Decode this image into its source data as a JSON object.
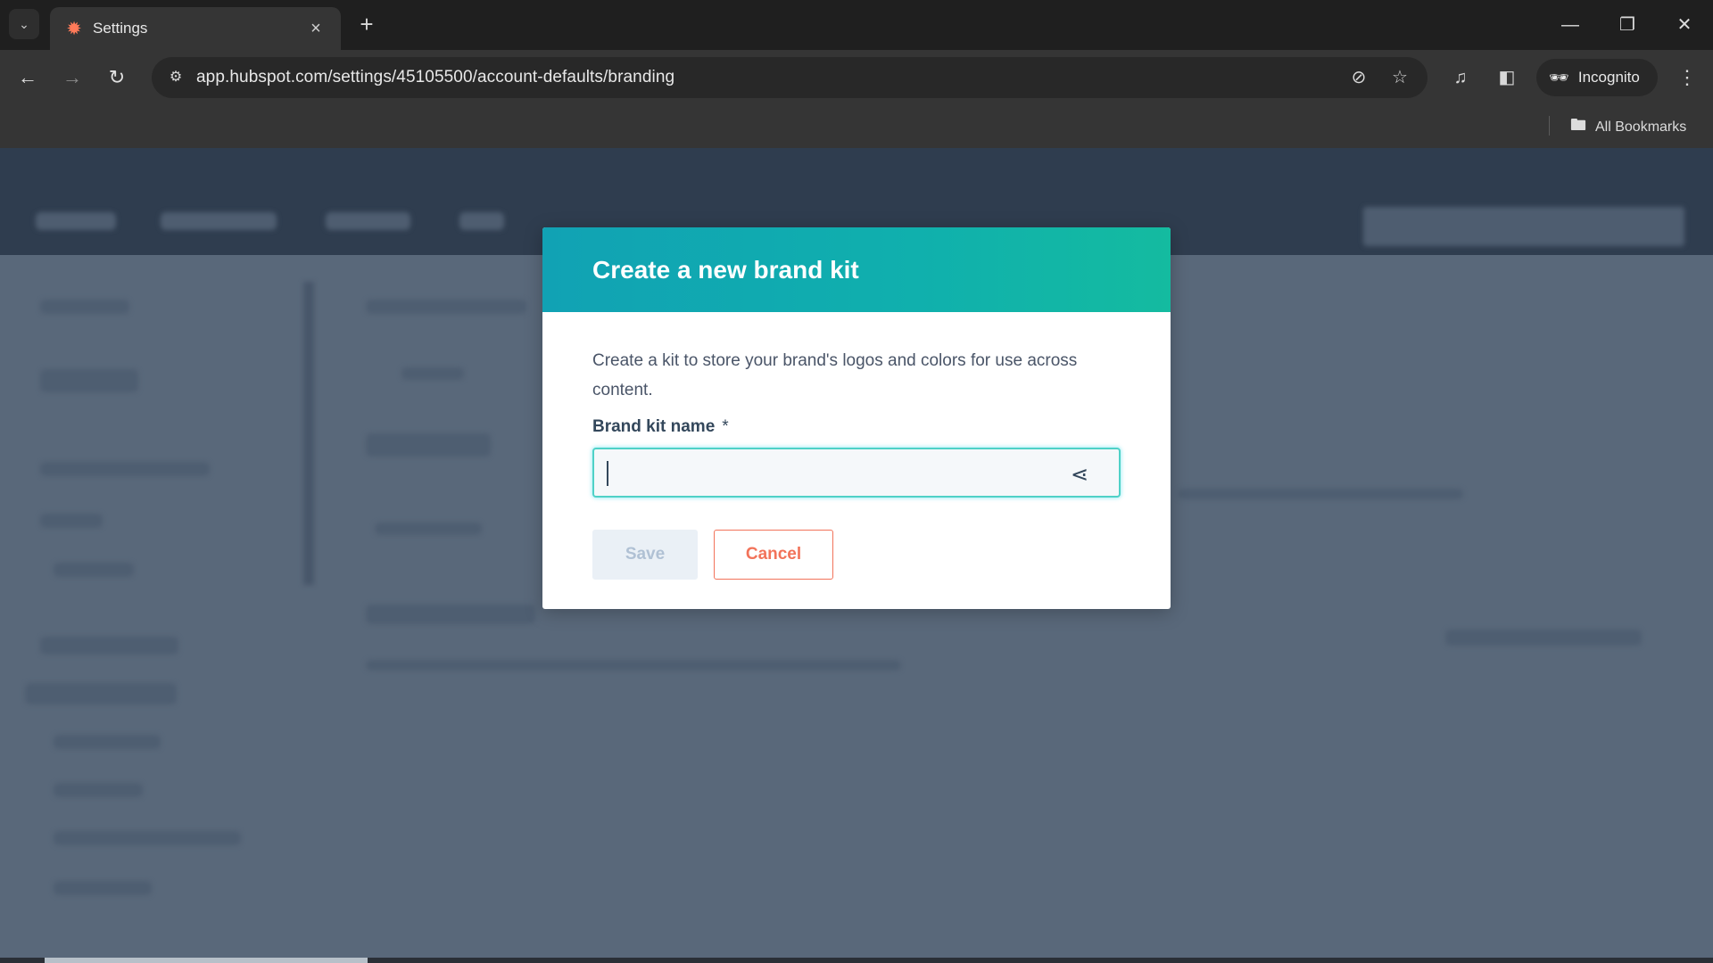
{
  "browser": {
    "tab": {
      "title": "Settings",
      "favicon": "hubspot-sprocket-icon"
    },
    "url": "app.hubspot.com/settings/45105500/account-defaults/branding",
    "profile_label": "Incognito",
    "bookmarks_label": "All Bookmarks",
    "icons": {
      "tab_search": "chevron-down-icon",
      "new_tab": "+",
      "back": "←",
      "forward": "→",
      "reload": "↻",
      "minimize": "—",
      "restore": "❐",
      "close": "✕",
      "tab_close": "×"
    }
  },
  "modal": {
    "title": "Create a new brand kit",
    "description": "Create a kit to store your brand's logos and colors for use across content.",
    "field": {
      "label": "Brand kit name",
      "required_marker": "*",
      "value": "",
      "placeholder": ""
    },
    "buttons": {
      "save": "Save",
      "cancel": "Cancel"
    },
    "colors": {
      "header_gradient_start": "#11a2b4",
      "header_gradient_end": "#14bba0",
      "cancel_accent": "#f2735a",
      "input_focus": "#4fd1c7"
    }
  }
}
